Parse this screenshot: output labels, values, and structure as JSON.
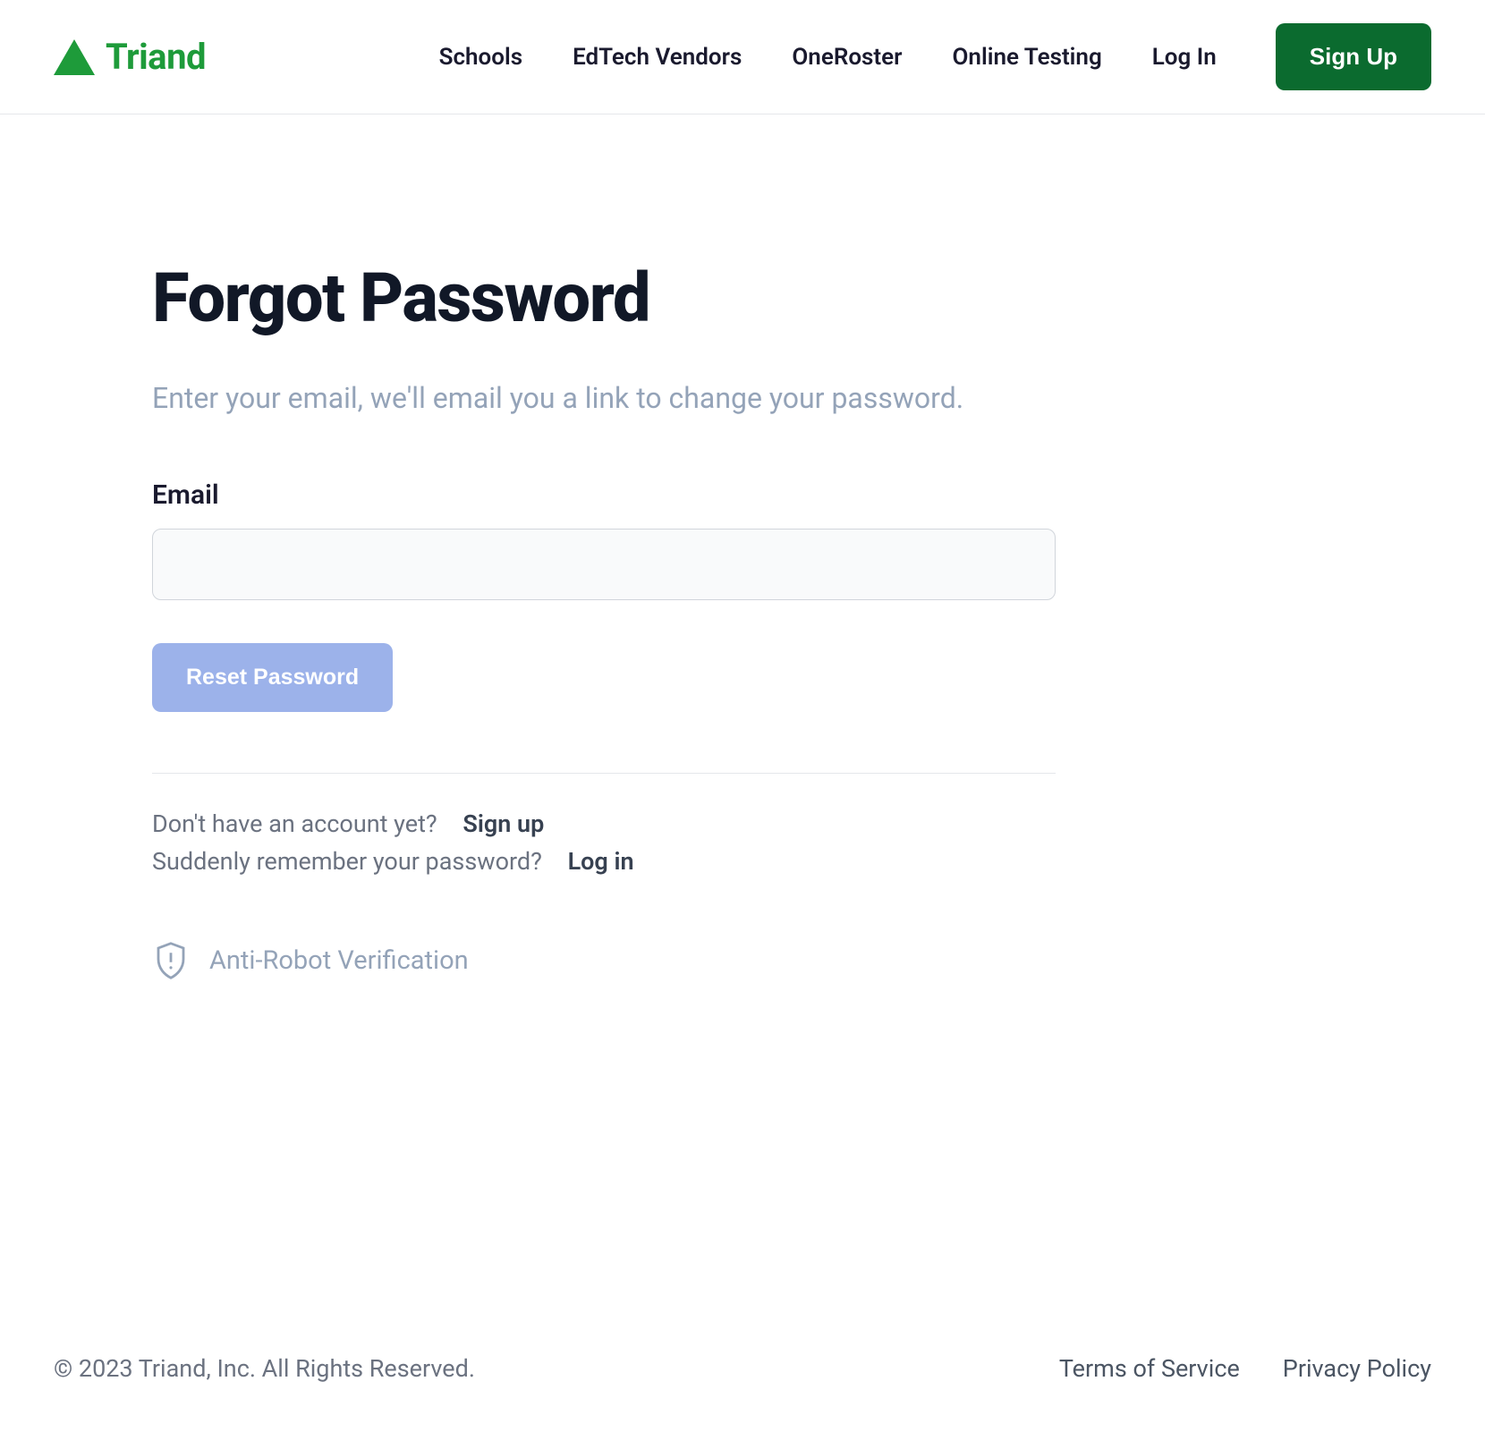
{
  "header": {
    "logo_text": "Triand",
    "nav": {
      "schools": "Schools",
      "edtech": "EdTech Vendors",
      "oneroster": "OneRoster",
      "onlinetesting": "Online Testing",
      "login": "Log In"
    },
    "signup_button": "Sign Up"
  },
  "main": {
    "title": "Forgot Password",
    "subtitle": "Enter your email, we'll email you a link to change your password.",
    "email_label": "Email",
    "email_value": "",
    "reset_button": "Reset Password",
    "no_account_text": "Don't have an account yet?",
    "signup_link": "Sign up",
    "remember_text": "Suddenly remember your password?",
    "login_link": "Log in",
    "anti_robot": "Anti-Robot Verification"
  },
  "footer": {
    "copyright": "© 2023  Triand, Inc. All Rights Reserved.",
    "terms": "Terms of Service",
    "privacy": "Privacy Policy"
  }
}
